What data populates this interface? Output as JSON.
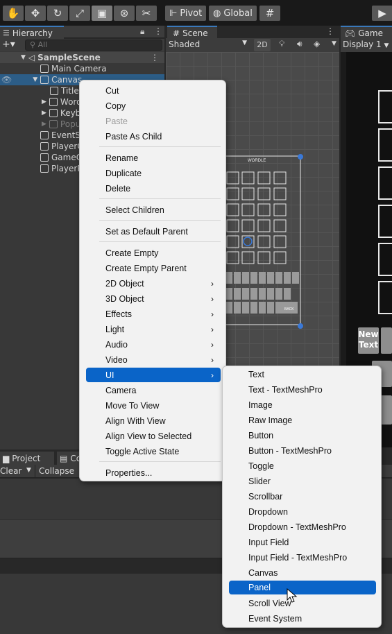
{
  "toolbar": {
    "pivot_label": "Pivot",
    "global_label": "Global"
  },
  "hierarchy": {
    "tab_label": "Hierarchy",
    "search_placeholder": "All",
    "items": [
      {
        "label": "SampleScene"
      },
      {
        "label": "Main Camera"
      },
      {
        "label": "Canvas"
      },
      {
        "label": "Title"
      },
      {
        "label": "Word"
      },
      {
        "label": "Keyb"
      },
      {
        "label": "Popu"
      },
      {
        "label": "EventS"
      },
      {
        "label": "PlayerC"
      },
      {
        "label": "GameC"
      },
      {
        "label": "PlayerP"
      }
    ]
  },
  "scene": {
    "tab_label": "Scene",
    "shading_mode": "Shaded",
    "mode_2d": "2D",
    "canvas_title": "WORDLE",
    "key_label": "New Text",
    "back_label": "BACK"
  },
  "game": {
    "tab_label": "Game",
    "display": "Display 1",
    "key_label_1": "New",
    "key_label_2": "Text"
  },
  "bottom": {
    "project_tab": "Project",
    "console_tab": "Co",
    "clear_label": "Clear",
    "collapse_label": "Collapse"
  },
  "context_menu": {
    "items": [
      {
        "label": "Cut"
      },
      {
        "label": "Copy"
      },
      {
        "label": "Paste"
      },
      {
        "label": "Paste As Child"
      },
      {
        "label": "Rename"
      },
      {
        "label": "Duplicate"
      },
      {
        "label": "Delete"
      },
      {
        "label": "Select Children"
      },
      {
        "label": "Set as Default Parent"
      },
      {
        "label": "Create Empty"
      },
      {
        "label": "Create Empty Parent"
      },
      {
        "label": "2D Object"
      },
      {
        "label": "3D Object"
      },
      {
        "label": "Effects"
      },
      {
        "label": "Light"
      },
      {
        "label": "Audio"
      },
      {
        "label": "Video"
      },
      {
        "label": "UI"
      },
      {
        "label": "Camera"
      },
      {
        "label": "Move To View"
      },
      {
        "label": "Align With View"
      },
      {
        "label": "Align View to Selected"
      },
      {
        "label": "Toggle Active State"
      },
      {
        "label": "Properties..."
      }
    ]
  },
  "ui_submenu": {
    "items": [
      {
        "label": "Text"
      },
      {
        "label": "Text - TextMeshPro"
      },
      {
        "label": "Image"
      },
      {
        "label": "Raw Image"
      },
      {
        "label": "Button"
      },
      {
        "label": "Button - TextMeshPro"
      },
      {
        "label": "Toggle"
      },
      {
        "label": "Slider"
      },
      {
        "label": "Scrollbar"
      },
      {
        "label": "Dropdown"
      },
      {
        "label": "Dropdown - TextMeshPro"
      },
      {
        "label": "Input Field"
      },
      {
        "label": "Input Field - TextMeshPro"
      },
      {
        "label": "Canvas"
      },
      {
        "label": "Panel"
      },
      {
        "label": "Scroll View"
      },
      {
        "label": "Event System"
      }
    ],
    "highlighted": "Panel"
  }
}
